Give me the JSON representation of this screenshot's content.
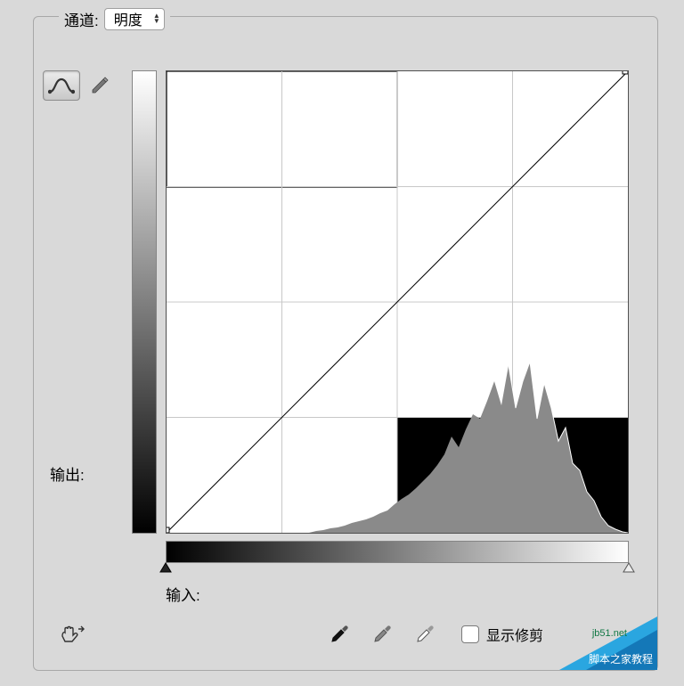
{
  "channel": {
    "label": "通道:",
    "selected": "明度"
  },
  "curves": {
    "output_label": "输出:",
    "input_label": "输入:",
    "input_black": 0,
    "input_white": 255,
    "points": [
      {
        "in": 0,
        "out": 0
      },
      {
        "in": 255,
        "out": 255
      }
    ]
  },
  "show_clipping": {
    "label": "显示修剪",
    "checked": false
  },
  "tools": {
    "curve_tool": "curve-tool",
    "pencil_tool": "pencil-tool",
    "active": "curve-tool"
  },
  "eyedroppers": {
    "black": "black-point",
    "gray": "gray-point",
    "white": "white-point"
  },
  "watermark": {
    "line1": "jb51.net",
    "line2": "脚本之家教程"
  },
  "chart_data": {
    "type": "line",
    "title": "",
    "xlabel": "输入",
    "ylabel": "输出",
    "xlim": [
      0,
      255
    ],
    "ylim": [
      0,
      255
    ],
    "series": [
      {
        "name": "curve",
        "x": [
          0,
          255
        ],
        "y": [
          0,
          255
        ]
      }
    ],
    "histogram": {
      "range": [
        0,
        255
      ],
      "bins": 64,
      "values": [
        0,
        0,
        0,
        0,
        0,
        0,
        0,
        0,
        0,
        0,
        0,
        0,
        0,
        0,
        0,
        0,
        0,
        0,
        0,
        0,
        0,
        0,
        2,
        3,
        4,
        5,
        6,
        8,
        8,
        9,
        11,
        13,
        14,
        18,
        21,
        24,
        28,
        32,
        36,
        42,
        48,
        58,
        52,
        62,
        70,
        68,
        78,
        88,
        76,
        94,
        72,
        86,
        96,
        66,
        84,
        70,
        52,
        60,
        40,
        36,
        24,
        18,
        10,
        4
      ]
    }
  }
}
